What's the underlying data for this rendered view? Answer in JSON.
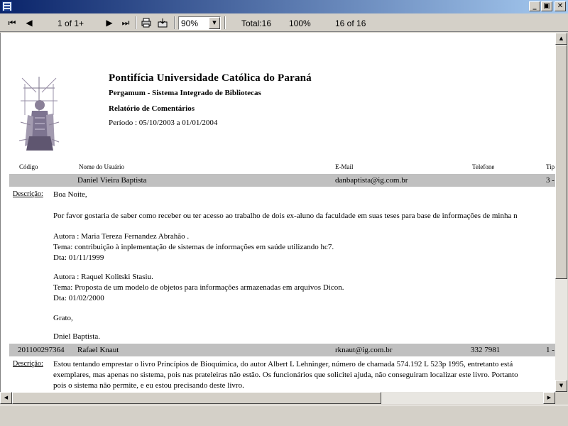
{
  "window": {
    "minimize": "_",
    "maximize": "▣",
    "close": "✕"
  },
  "toolbar": {
    "page_indicator": "1 of 1+",
    "zoom_value": "90%",
    "total": "Total:16",
    "percent": "100%",
    "count": "16 of 16",
    "first_icon": "first-page-icon",
    "prev_icon": "previous-page-icon",
    "next_icon": "next-page-icon",
    "last_icon": "last-page-icon",
    "print_icon": "print-icon",
    "export_icon": "export-icon"
  },
  "report": {
    "title": "Pontifícia Universidade Católica do Paraná",
    "subtitle": "Pergamum - Sistema Integrado de Bibliotecas",
    "report_name": "Relatório de Comentários",
    "period": "Período : 05/10/2003 a 01/01/2004",
    "columns": {
      "codigo": "Código",
      "nome": "Nome do Usuário",
      "email": "E-Mail",
      "telefone": "Telefone",
      "tipo": "Tip"
    },
    "records": [
      {
        "code": "",
        "name": "Daniel Vieira Baptista",
        "email": "danbaptista@ig.com.br",
        "phone": "",
        "type": "3 -",
        "desc_label": "Descrição:",
        "lines": [
          "Boa Noite,",
          "",
          "Por favor gostaria de saber como receber ou ter acesso ao trabalho de dois ex-aluno da faculdade em suas teses para base de informações de minha n",
          "",
          "Autora : Maria Tereza Fernandez Abrahão .",
          "Tema: contribuição à inplementação de sistemas de informações em saúde utilizando hc7.",
          "Dta: 01/11/1999",
          "",
          "Autora : Raquel Kolitski Stasiu.",
          "Tema: Proposta de um modelo de objetos para informações armazenadas em arquivos Dicon.",
          "Dta: 01/02/2000",
          "",
          "Grato,",
          "",
          "Dniel Baptista."
        ]
      },
      {
        "code": "201100297364",
        "name": "Rafael Knaut",
        "email": "rknaut@ig.com.br",
        "phone": "332 7981",
        "type": "1 -",
        "desc_label": "Descrição:",
        "lines": [
          "Estou tentando emprestar o livro Princípios de Bioquímica, do autor Albert L Lehninger, número de chamada 574.192 L 523p  1995, entretanto está",
          "exemplares, mas apenas no sistema, pois nas prateleiras não estão. Os funcionários que solicitei ajuda, não conseguiram localizar este livro. Portanto",
          "pois o sistema não permite, e eu estou precisando deste livro."
        ]
      }
    ]
  }
}
